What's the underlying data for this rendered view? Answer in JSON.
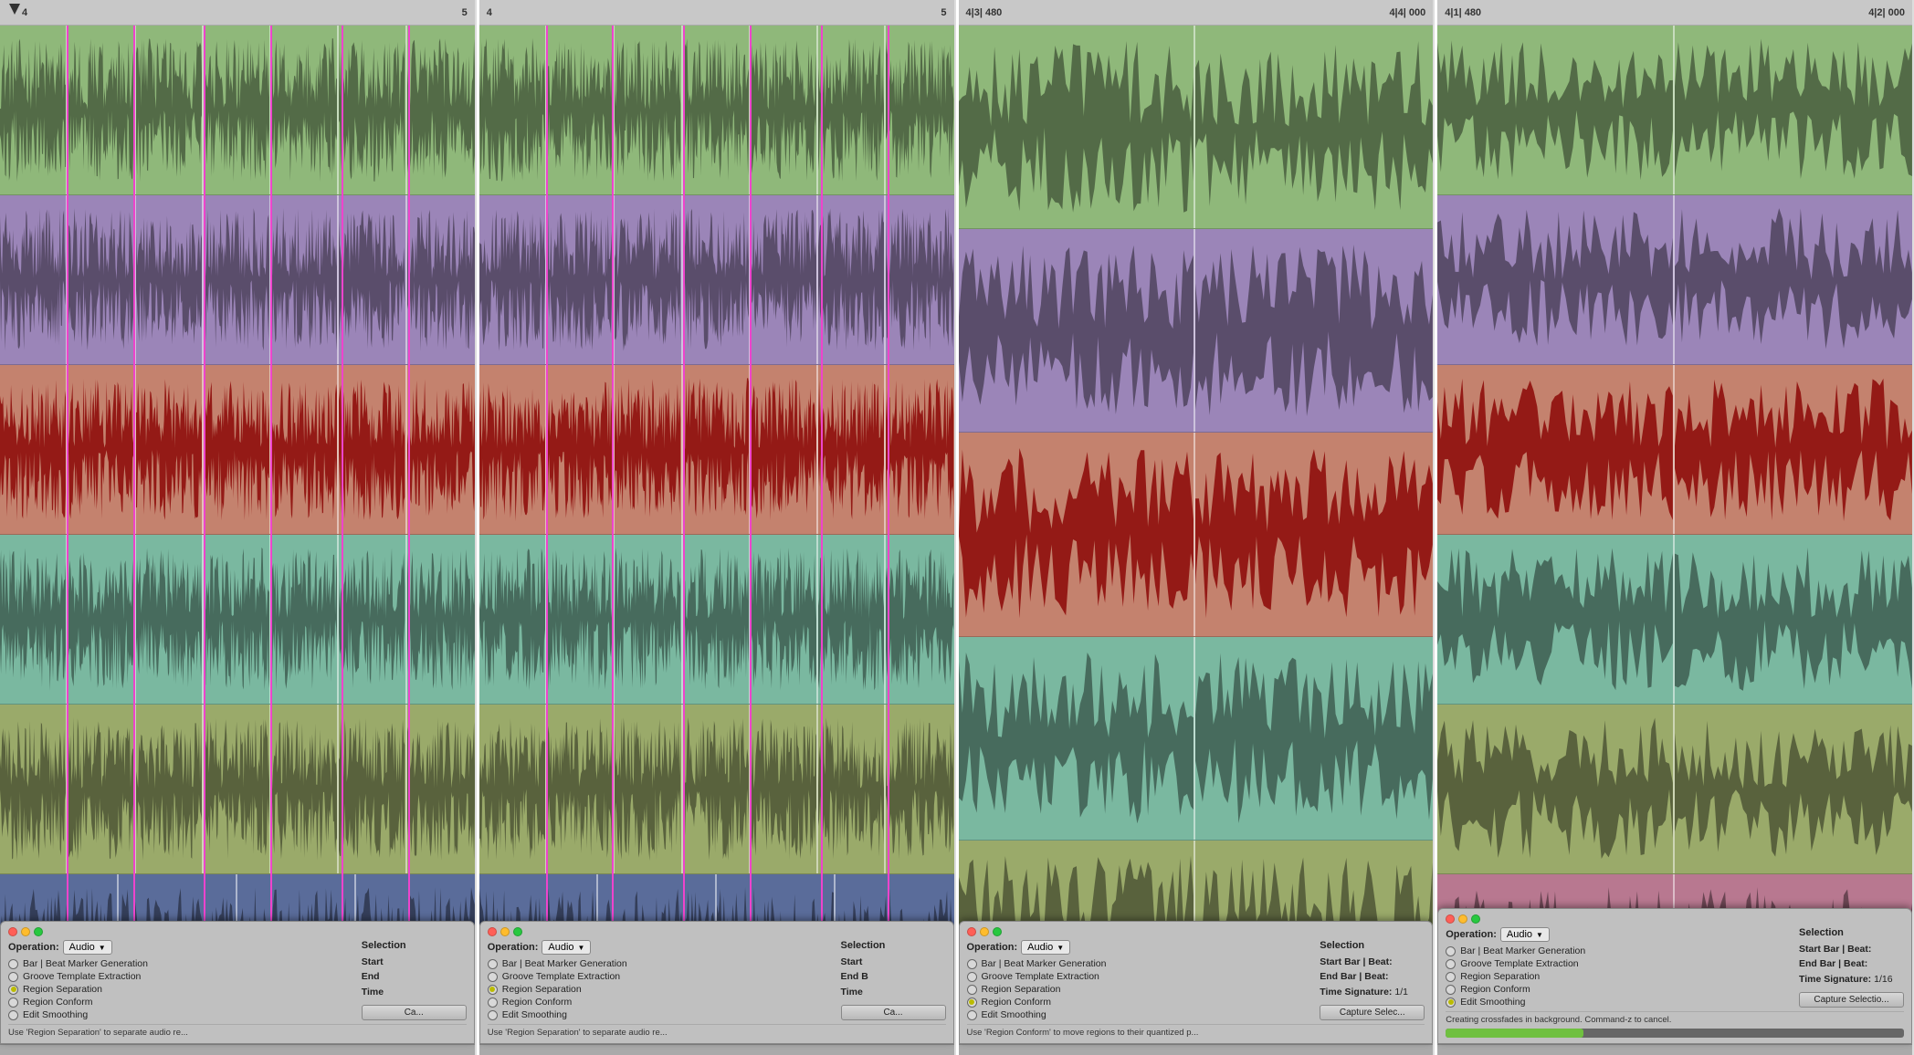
{
  "panels": [
    {
      "id": "panel-1",
      "ruler": {
        "left_label": "4",
        "right_label": "5",
        "has_cursor": true
      },
      "tracks": [
        {
          "color": "track-green",
          "segments": 7
        },
        {
          "color": "track-purple",
          "segments": 7
        },
        {
          "color": "track-salmon",
          "segments": 7
        },
        {
          "color": "track-teal",
          "segments": 7
        },
        {
          "color": "track-olive",
          "segments": 7
        },
        {
          "color": "track-navy",
          "segments": 4
        }
      ],
      "sel_lines": [
        12,
        27,
        42,
        57,
        72,
        87
      ],
      "dialog": {
        "operation_label": "Operation:",
        "operation_value": "Audio",
        "radio_items": [
          {
            "label": "Bar | Beat Marker Generation",
            "selected": false
          },
          {
            "label": "Groove Template Extraction",
            "selected": false
          },
          {
            "label": "Region Separation",
            "selected": true
          },
          {
            "label": "Region Conform",
            "selected": false
          },
          {
            "label": "Edit Smoothing",
            "selected": false
          }
        ],
        "selection": {
          "show": true,
          "rows": [
            {
              "label": "Start",
              "value": ""
            },
            {
              "label": "End",
              "value": ""
            },
            {
              "label": "Time",
              "value": ""
            }
          ]
        },
        "capture_btn": "Ca...",
        "footer": "Use 'Region Separation' to separate audio re..."
      }
    },
    {
      "id": "panel-2",
      "ruler": {
        "left_label": "4",
        "right_label": "5",
        "has_cursor": false
      },
      "tracks": [
        {
          "color": "track-green",
          "segments": 7
        },
        {
          "color": "track-purple",
          "segments": 7
        },
        {
          "color": "track-salmon",
          "segments": 7
        },
        {
          "color": "track-teal",
          "segments": 7
        },
        {
          "color": "track-olive",
          "segments": 7
        },
        {
          "color": "track-navy",
          "segments": 4
        }
      ],
      "sel_lines": [],
      "dialog": {
        "operation_label": "Operation:",
        "operation_value": "Audio",
        "radio_items": [
          {
            "label": "Bar | Beat Marker Generation",
            "selected": false
          },
          {
            "label": "Groove Template Extraction",
            "selected": false
          },
          {
            "label": "Region Separation",
            "selected": true
          },
          {
            "label": "Region Conform",
            "selected": false
          },
          {
            "label": "Edit Smoothing",
            "selected": false
          }
        ],
        "selection": {
          "show": true,
          "rows": [
            {
              "label": "Start",
              "value": ""
            },
            {
              "label": "End B",
              "value": ""
            },
            {
              "label": "Time",
              "value": ""
            }
          ]
        },
        "capture_btn": "Ca...",
        "footer": "Use 'Region Separation' to separate audio re..."
      }
    },
    {
      "id": "panel-3",
      "ruler": {
        "left_label": "4|3| 480",
        "right_label": "4|4| 000",
        "has_cursor": false
      },
      "tracks": [
        {
          "color": "track-green",
          "segments": 2
        },
        {
          "color": "track-purple",
          "segments": 2
        },
        {
          "color": "track-salmon",
          "segments": 2
        },
        {
          "color": "track-teal",
          "segments": 2
        },
        {
          "color": "track-olive",
          "segments": 2
        }
      ],
      "sel_lines": [],
      "dialog": {
        "operation_label": "Operation:",
        "operation_value": "Audio",
        "radio_items": [
          {
            "label": "Bar | Beat Marker Generation",
            "selected": false
          },
          {
            "label": "Groove Template Extraction",
            "selected": false
          },
          {
            "label": "Region Separation",
            "selected": false
          },
          {
            "label": "Region Conform",
            "selected": true
          },
          {
            "label": "Edit Smoothing",
            "selected": false
          }
        ],
        "selection": {
          "show": true,
          "rows": [
            {
              "label": "Start Bar | Beat:",
              "value": ""
            },
            {
              "label": "End Bar | Beat:",
              "value": ""
            },
            {
              "label": "Time Signature:",
              "value": "1/1"
            }
          ]
        },
        "capture_btn": "Capture Selec...",
        "footer": "Use 'Region Conform' to move regions to their quantized p..."
      }
    },
    {
      "id": "panel-4",
      "ruler": {
        "left_label": "4|1| 480",
        "right_label": "4|2| 000",
        "has_cursor": false
      },
      "tracks": [
        {
          "color": "track-green",
          "segments": 2
        },
        {
          "color": "track-purple",
          "segments": 2
        },
        {
          "color": "track-salmon",
          "segments": 2
        },
        {
          "color": "track-teal",
          "segments": 2
        },
        {
          "color": "track-olive",
          "segments": 2
        },
        {
          "color": "track-mauve",
          "segments": 2
        }
      ],
      "sel_lines": [],
      "dialog": {
        "operation_label": "Operation:",
        "operation_value": "Audio",
        "radio_items": [
          {
            "label": "Bar | Beat Marker Generation",
            "selected": false
          },
          {
            "label": "Groove Template Extraction",
            "selected": false
          },
          {
            "label": "Region Separation",
            "selected": false
          },
          {
            "label": "Region Conform",
            "selected": false
          },
          {
            "label": "Edit Smoothing",
            "selected": true
          }
        ],
        "selection": {
          "show": true,
          "rows": [
            {
              "label": "Start Bar | Beat:",
              "value": ""
            },
            {
              "label": "End Bar | Beat:",
              "value": ""
            },
            {
              "label": "Time Signature:",
              "value": "1/16"
            }
          ]
        },
        "capture_btn": "Capture Selectio...",
        "footer": "Creating crossfades in background. Command-z to cancel.",
        "progress": 30
      }
    }
  ],
  "track_colors": {
    "track-green": "#8fb87a",
    "track-purple": "#9b85b8",
    "track-salmon": "#c4826e",
    "track-teal": "#7ab8a0",
    "track-olive": "#9aaa6a",
    "track-navy": "#5a6c9a",
    "track-mauve": "#b87890"
  }
}
